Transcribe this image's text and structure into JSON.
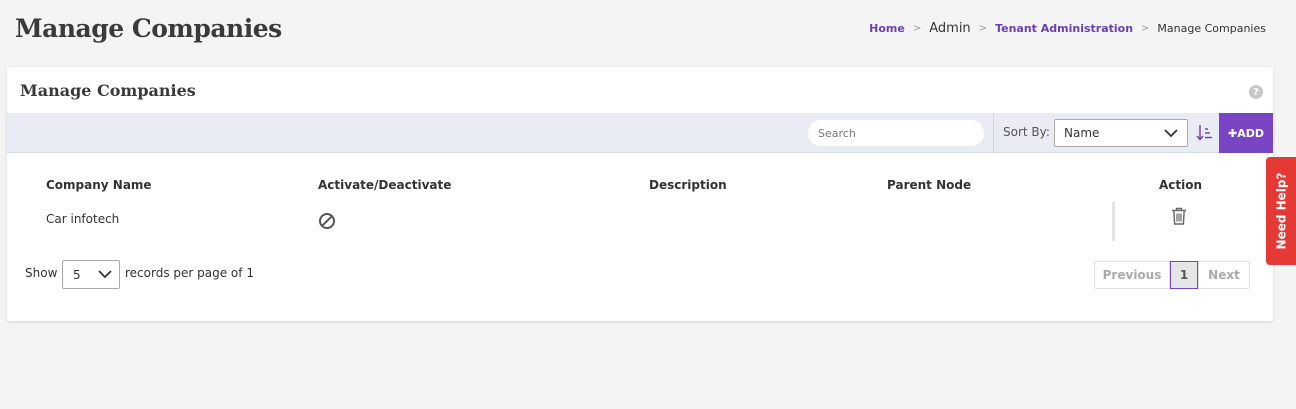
{
  "page": {
    "title": "Manage Companies"
  },
  "breadcrumb": {
    "home": "Home",
    "admin": "Admin",
    "tenant_admin": "Tenant Administration",
    "current": "Manage Companies",
    "separator": ">"
  },
  "card": {
    "title": "Manage Companies",
    "help_glyph": "?"
  },
  "toolbar": {
    "search_placeholder": "Search",
    "sort_label": "Sort By:",
    "sort_value": "Name",
    "add_label": "✚ADD"
  },
  "table": {
    "columns": [
      "Company Name",
      "Activate/Deactivate",
      "Description",
      "Parent Node",
      "Action"
    ],
    "rows": [
      {
        "company_name": "Car infotech",
        "description": "",
        "parent_node": ""
      }
    ]
  },
  "pagination": {
    "show_label": "Show",
    "page_size": "5",
    "records_label": "records per page of 1",
    "prev": "Previous",
    "current_page": "1",
    "next": "Next"
  },
  "need_help": "Need Help?",
  "colors": {
    "accent": "#7a45c4",
    "link": "#6c3fb5",
    "help_tab": "#e53935",
    "toolbar_bg": "#e9ecf4"
  },
  "icons": {
    "help": "question-circle-icon",
    "sort_order": "sort-ascending-icon",
    "deactivate": "ban-icon",
    "delete": "trash-icon",
    "dropdown": "chevron-down-icon"
  }
}
